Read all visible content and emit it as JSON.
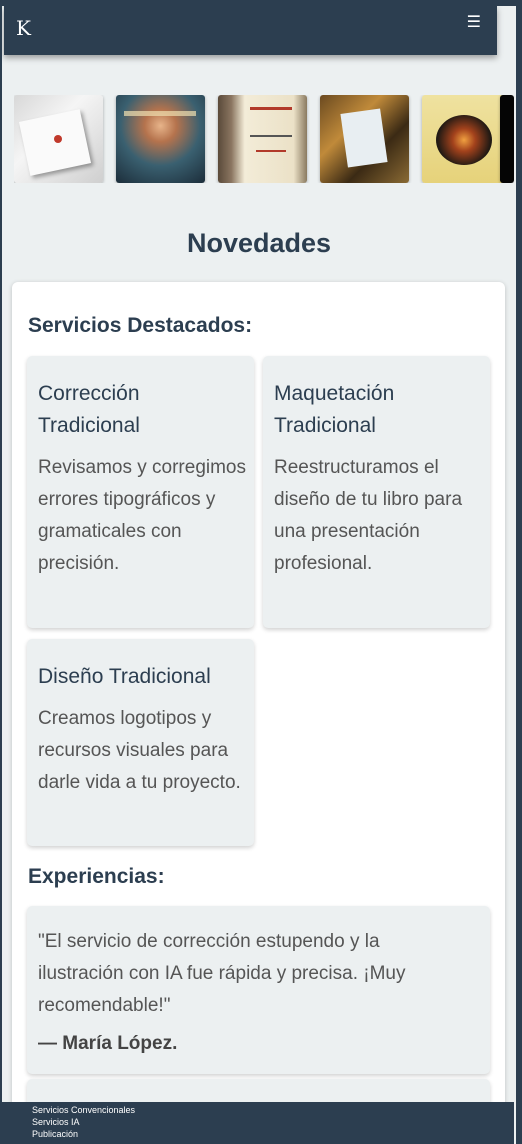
{
  "header": {
    "logo_text": "K",
    "menu_icon": "☰"
  },
  "carousel": {
    "books": [
      "book-cover-white",
      "book-cover-woman-portrait",
      "book-cover-classic-hardcover",
      "book-cover-photo-collage",
      "book-cover-garcia-marquez",
      "book-cover-black"
    ]
  },
  "news": {
    "title": "Novedades"
  },
  "services": {
    "title": "Servicios Destacados:",
    "items": [
      {
        "title": "Corrección Tradicional",
        "desc": "Revisamos y corregimos errores tipográficos y gramaticales con precisión."
      },
      {
        "title": "Maquetación Tradicional",
        "desc": "Reestructuramos el diseño de tu libro para una presentación profesional."
      },
      {
        "title": "Diseño Tradicional",
        "desc": "Creamos logotipos y recursos visuales para darle vida a tu proyecto."
      }
    ]
  },
  "experiences": {
    "title": "Experiencias:",
    "items": [
      {
        "quote": "\"El servicio de corrección estupendo y la ilustración con IA fue rápida y precisa. ¡Muy recomendable!\"",
        "author": "— María López."
      }
    ]
  },
  "footer": {
    "links": [
      "Servicios Convencionales",
      "Servicios IA",
      "Publicación"
    ]
  }
}
